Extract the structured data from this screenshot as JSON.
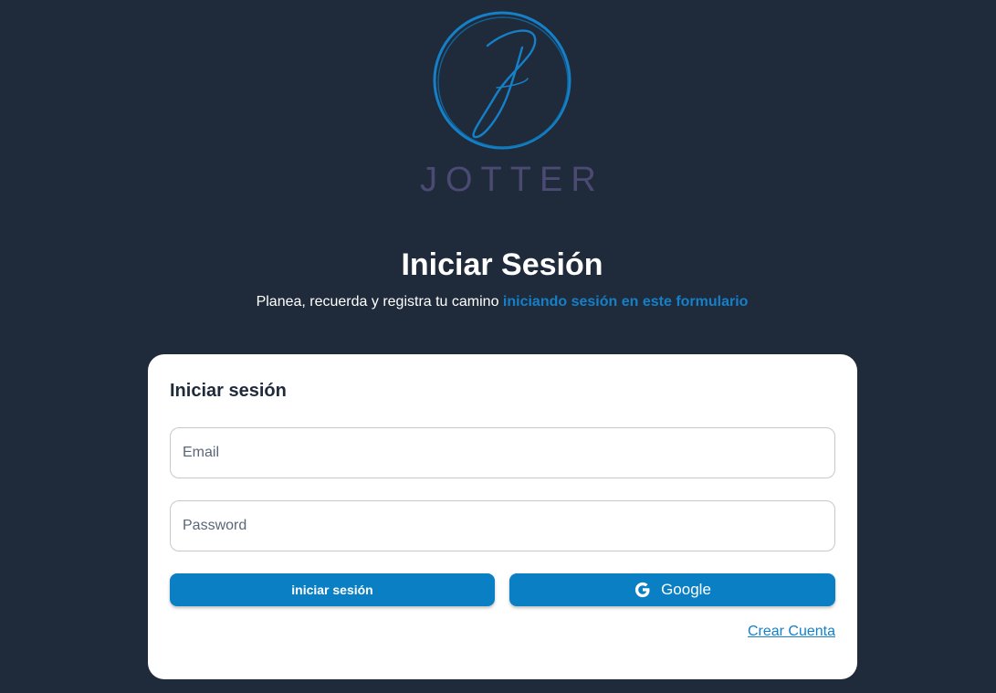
{
  "brand": {
    "name": "JOTTER",
    "monogram": "J",
    "icon": "jotter-logo"
  },
  "header": {
    "title": "Iniciar Sesión",
    "subtitle_prefix": "Planea, recuerda y registra tu camino ",
    "subtitle_highlight": "iniciando sesión en este formulario"
  },
  "form": {
    "title": "Iniciar sesión",
    "email": {
      "value": "",
      "placeholder": "Email"
    },
    "password": {
      "value": "",
      "placeholder": "Password"
    },
    "login_button": "iniciar sesión",
    "google_button": "Google",
    "google_icon": "google-icon",
    "create_account_link": "Crear Cuenta"
  },
  "colors": {
    "background": "#1f2a3b",
    "accent": "#0b7fc4",
    "link": "#1580c8",
    "card": "#ffffff",
    "logo_text": "#4b4a72"
  }
}
